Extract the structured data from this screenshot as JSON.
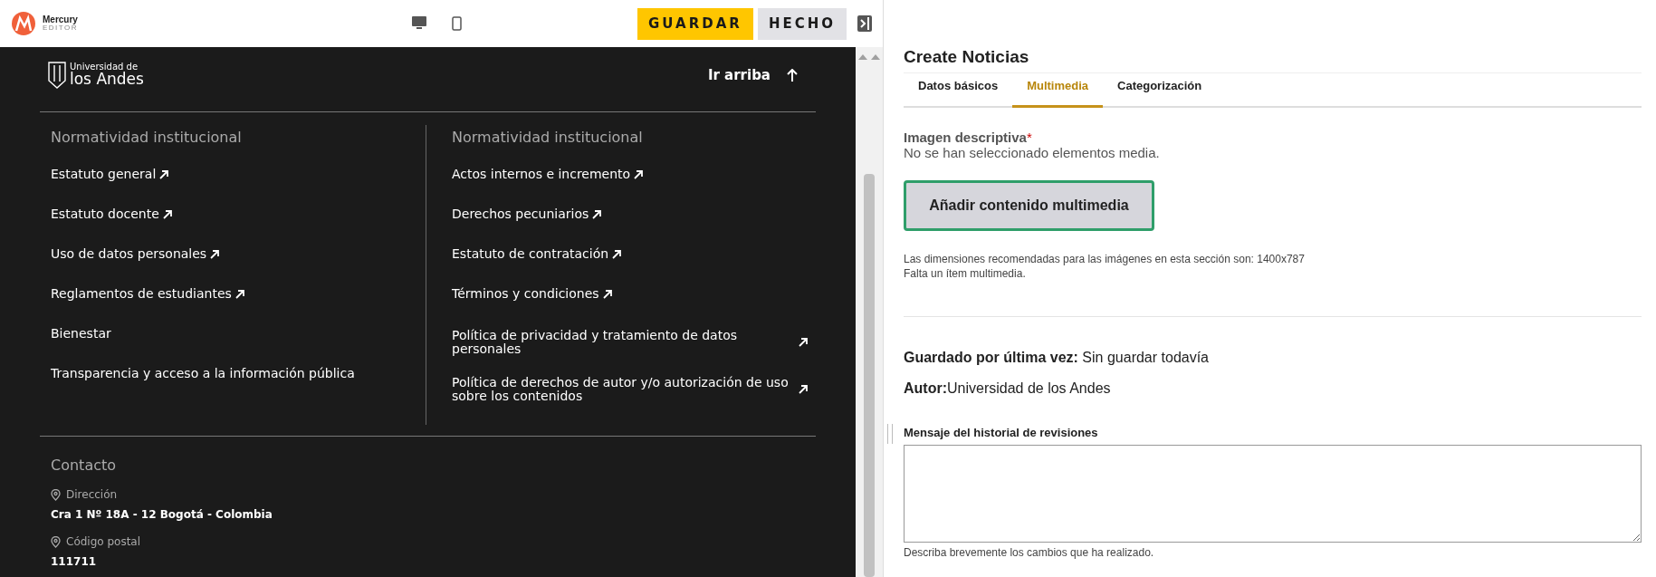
{
  "toolbar": {
    "brand": "Mercury",
    "brand_sub": "EDITOR",
    "devices": [
      {
        "kind": "desktop"
      },
      {
        "kind": "mobile"
      }
    ],
    "buttons": [
      {
        "label": "GUARDAR",
        "kind": "primary"
      },
      {
        "label": "HECHO",
        "kind": "secondary"
      }
    ]
  },
  "footer": {
    "logo_line1": "Universidad de",
    "logo_line2": "los Andes",
    "back_to_top": "Ir arriba",
    "columns": [
      {
        "heading": "Normatividad institucional",
        "links": [
          {
            "label": "Estatuto general",
            "external": true
          },
          {
            "label": "Estatuto docente",
            "external": true
          },
          {
            "label": "Uso de datos personales",
            "external": true
          },
          {
            "label": "Reglamentos de estudiantes",
            "external": true
          },
          {
            "label": "Bienestar",
            "external": false
          },
          {
            "label": "Transparencia y acceso a la información pública",
            "external": false
          }
        ]
      },
      {
        "heading": "Normatividad institucional",
        "links": [
          {
            "label": "Actos internos e incremento",
            "external": true
          },
          {
            "label": "Derechos pecuniarios",
            "external": true
          },
          {
            "label": "Estatuto de contratación",
            "external": true
          },
          {
            "label": "Términos y condiciones",
            "external": true
          },
          {
            "label": "Política de privacidad y tratamiento de datos personales",
            "external": true,
            "wide": true
          },
          {
            "label": "Política de derechos de autor y/o autorización de uso sobre los contenidos",
            "external": true,
            "wide": true
          }
        ]
      }
    ],
    "contact": {
      "heading": "Contacto",
      "entries": [
        {
          "label": "Dirección",
          "value": "Cra 1 Nº 18A - 12 Bogotá - Colombia"
        },
        {
          "label": "Código postal",
          "value": "111711"
        }
      ]
    }
  },
  "panel": {
    "title": "Create Noticias",
    "tabs": [
      {
        "label": "Datos básicos",
        "selected": false
      },
      {
        "label": "Multimedia",
        "selected": true
      },
      {
        "label": "Categorización",
        "selected": false
      }
    ],
    "media": {
      "label": "Imagen descriptiva",
      "required_mark": "*",
      "empty_text": "No se han seleccionado elementos media.",
      "button": "Añadir contenido multimedia",
      "hints": [
        "Las dimensiones recomendadas para las imágenes en esta sección son: 1400x787",
        "Falta un ítem multimedia."
      ]
    },
    "meta": [
      {
        "label": "Guardado por última vez:",
        "value": " Sin guardar todavía"
      },
      {
        "label": "Autor:",
        "value": "Universidad de los Andes"
      }
    ],
    "revision": {
      "label": "Mensaje del historial de revisiones",
      "hint": "Describa brevemente los cambios que ha realizado."
    }
  }
}
